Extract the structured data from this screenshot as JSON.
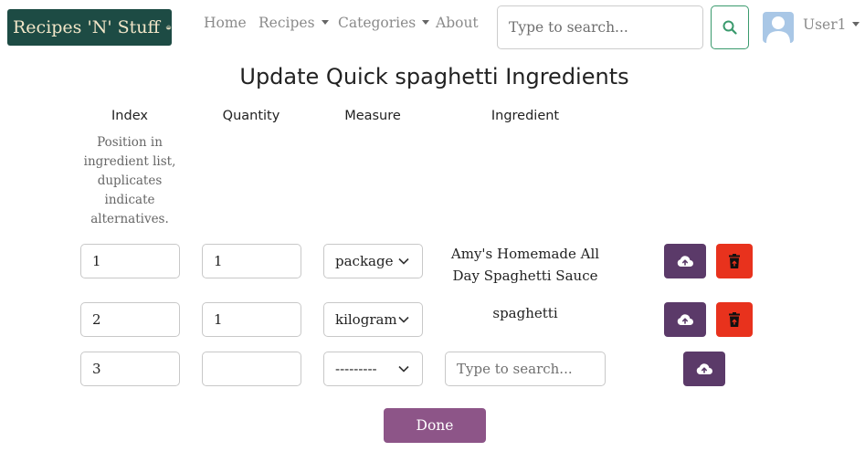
{
  "navbar": {
    "brand": "Recipes 'N' Stuff",
    "links": {
      "home": "Home",
      "recipes": "Recipes",
      "categories": "Categories",
      "about": "About"
    },
    "search_placeholder": "Type to search...",
    "user": "User1"
  },
  "page": {
    "title": "Update Quick spaghetti Ingredients"
  },
  "columns": {
    "index": "Index",
    "index_help": "Position in ingredient list, duplicates indicate alternatives.",
    "quantity": "Quantity",
    "measure": "Measure",
    "ingredient": "Ingredient"
  },
  "rows": [
    {
      "index": "1",
      "quantity": "1",
      "measure": "package",
      "ingredient": "Amy's Homemade All Day Spaghetti Sauce"
    },
    {
      "index": "2",
      "quantity": "1",
      "measure": "kilogram",
      "ingredient": "spaghetti"
    }
  ],
  "new_row": {
    "index": "3",
    "quantity": "",
    "measure": "---------",
    "ingredient_placeholder": "Type to search..."
  },
  "done_label": "Done",
  "colors": {
    "brand_bg": "#1d4b44",
    "upload_button": "#5b3a69",
    "delete_button": "#e8321d",
    "done_button": "#8d5588",
    "search_border": "#3a9a6d"
  }
}
